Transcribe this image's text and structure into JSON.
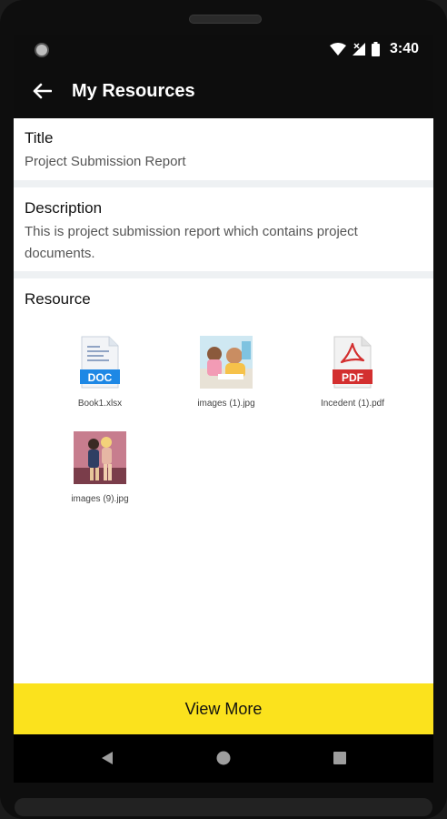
{
  "status": {
    "time": "3:40"
  },
  "appbar": {
    "title": "My Resources"
  },
  "title_section": {
    "label": "Title",
    "value": "Project Submission Report"
  },
  "description_section": {
    "label": "Description",
    "value": "This is project submission report which contains project documents."
  },
  "resource_section": {
    "label": "Resource",
    "items": [
      {
        "name": "Book1.xlsx",
        "icon": "doc-file-icon",
        "badge": "DOC"
      },
      {
        "name": "images (1).jpg",
        "icon": "image-thumbnail"
      },
      {
        "name": "Incedent (1).pdf",
        "icon": "pdf-file-icon",
        "badge": "PDF"
      },
      {
        "name": "images (9).jpg",
        "icon": "image-thumbnail"
      }
    ]
  },
  "footer": {
    "view_more_label": "View More"
  },
  "colors": {
    "accent": "#fbe21d",
    "appbar": "#0d0d0d",
    "doc_blue": "#1e88e5",
    "pdf_red": "#d32f2f"
  }
}
